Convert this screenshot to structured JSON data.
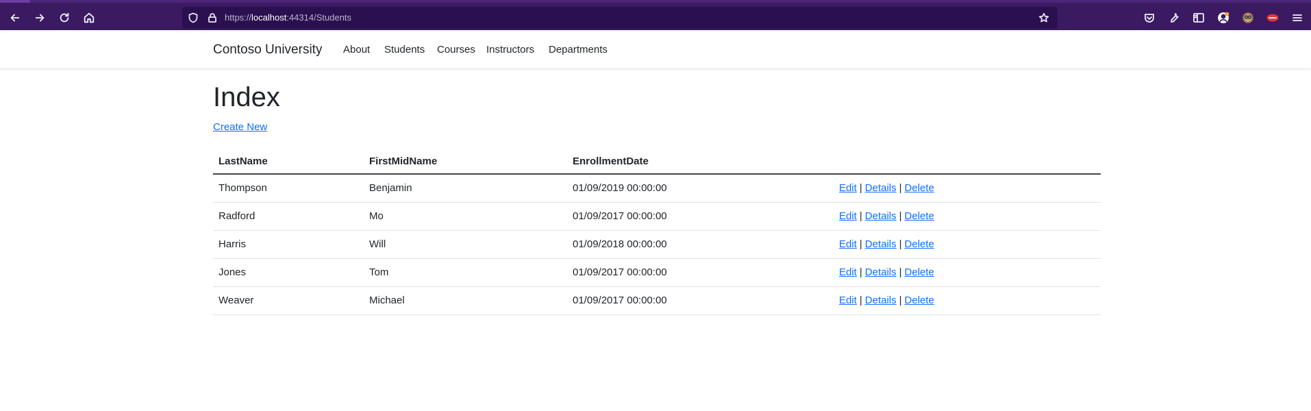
{
  "browser": {
    "url_prefix": "https://",
    "url_host": "localhost",
    "url_rest": ":44314/Students"
  },
  "site": {
    "brand": "Contoso University",
    "nav": [
      "About",
      "Students",
      "Courses",
      "Instructors",
      "Departments"
    ]
  },
  "page": {
    "title": "Index",
    "create_link": "Create New"
  },
  "table": {
    "headers": [
      "LastName",
      "FirstMidName",
      "EnrollmentDate",
      ""
    ],
    "rows": [
      {
        "last": "Thompson",
        "first": "Benjamin",
        "date": "01/09/2019 00:00:00"
      },
      {
        "last": "Radford",
        "first": "Mo",
        "date": "01/09/2017 00:00:00"
      },
      {
        "last": "Harris",
        "first": "Will",
        "date": "01/09/2018 00:00:00"
      },
      {
        "last": "Jones",
        "first": "Tom",
        "date": "01/09/2017 00:00:00"
      },
      {
        "last": "Weaver",
        "first": "Michael",
        "date": "01/09/2017 00:00:00"
      }
    ],
    "actions": {
      "edit": "Edit",
      "details": "Details",
      "delete": "Delete",
      "separator": "|"
    }
  },
  "colors": {
    "browser_bg": "#3b1a62",
    "urlbar_bg": "#2b1050",
    "link": "#0d6efd",
    "text": "#212529"
  }
}
